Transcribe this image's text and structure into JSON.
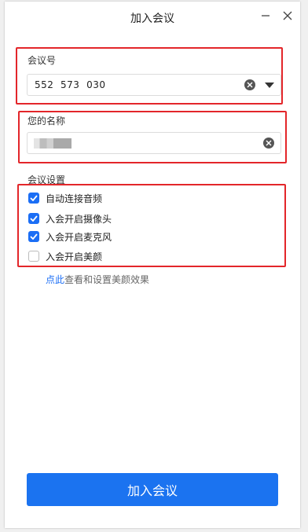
{
  "window": {
    "title": "加入会议"
  },
  "meeting_id": {
    "label": "会议号",
    "value": "552  573  030"
  },
  "name": {
    "label": "您的名称"
  },
  "settings": {
    "label": "会议设置",
    "options": [
      {
        "label": "自动连接音频",
        "checked": true
      },
      {
        "label": "入会开启摄像头",
        "checked": true
      },
      {
        "label": "入会开启麦克风",
        "checked": true
      },
      {
        "label": "入会开启美颜",
        "checked": false
      }
    ]
  },
  "beauty_hint": {
    "link": "点此",
    "text": "查看和设置美颜效果"
  },
  "join_button": {
    "label": "加入会议"
  },
  "colors": {
    "accent": "#1b73f0",
    "highlight": "#e3262a"
  }
}
